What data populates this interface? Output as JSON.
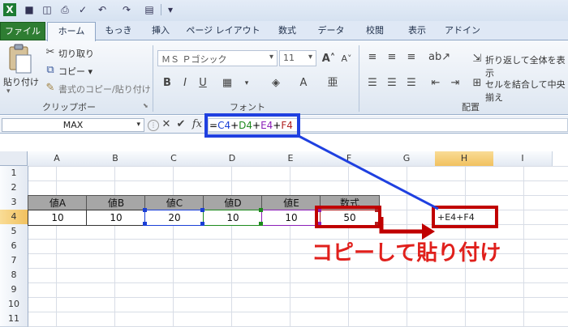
{
  "qat": {
    "icons": [
      "excel-app-icon",
      "save-icon",
      "print-preview-icon",
      "print-icon",
      "spell-check-icon",
      "undo-icon",
      "redo-icon",
      "customize-icon"
    ]
  },
  "tabs": {
    "file": "ファイル",
    "home": "ホーム",
    "items": [
      "もっき",
      "挿入",
      "ページ レイアウト",
      "数式",
      "データ",
      "校閲",
      "表示",
      "アドイン"
    ]
  },
  "ribbon": {
    "clipboard": {
      "paste": "貼り付け",
      "cut": "切り取り",
      "copy": "コピー ▾",
      "format_painter": "書式のコピー/貼り付け",
      "group": "クリップボード"
    },
    "font": {
      "name": "ＭＳ Ｐゴシック",
      "size": "11",
      "bold": "B",
      "italic": "I",
      "underline": "U",
      "group": "フォント"
    },
    "alignment": {
      "wrap": "折り返して全体を表示",
      "merge": "セルを結合して中央揃え",
      "group": "配置"
    }
  },
  "formula_bar": {
    "name_box": "MAX",
    "fx": "fx",
    "formula_parts": [
      {
        "text": "=",
        "color": "#000000"
      },
      {
        "text": "C4",
        "color": "#1a3fd6"
      },
      {
        "text": "+",
        "color": "#000000"
      },
      {
        "text": "D4",
        "color": "#1e8a1e"
      },
      {
        "text": "+",
        "color": "#000000"
      },
      {
        "text": "E4",
        "color": "#8b1fb8"
      },
      {
        "text": "+",
        "color": "#000000"
      },
      {
        "text": "F4",
        "color": "#b02020"
      }
    ]
  },
  "sheet": {
    "columns": [
      "A",
      "B",
      "C",
      "D",
      "E",
      "F",
      "G",
      "H",
      "I"
    ],
    "rows": [
      "1",
      "2",
      "3",
      "4",
      "5",
      "6",
      "7",
      "8",
      "9",
      "10",
      "11"
    ],
    "headers": [
      "値A",
      "値B",
      "値C",
      "値D",
      "値E",
      "数式"
    ],
    "values": [
      "10",
      "10",
      "20",
      "10",
      "10",
      "50"
    ],
    "h4_text": "+E4+F4"
  },
  "annotation": {
    "text": "コピーして貼り付け",
    "color": "#e0201c",
    "highlight_color": "#c00000",
    "formula_box_color": "#1f40e0"
  }
}
